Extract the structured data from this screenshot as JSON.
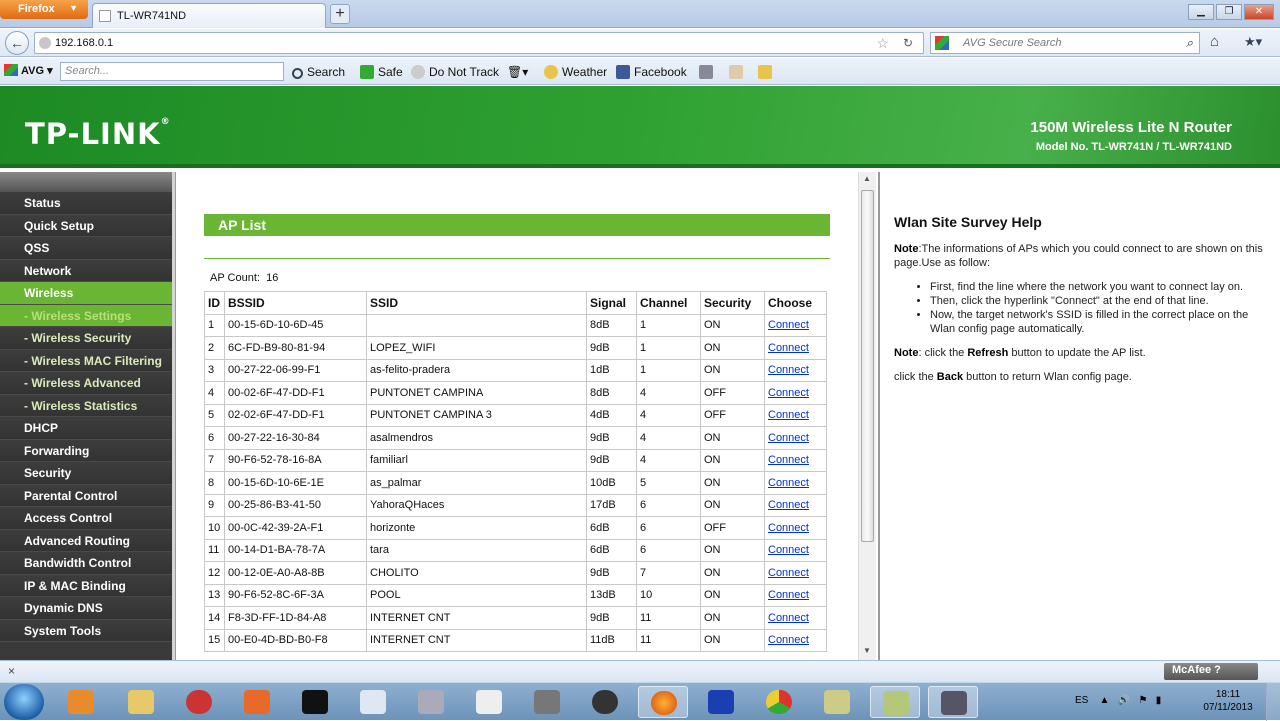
{
  "browser": {
    "menu_button": "Firefox",
    "tab_title": "TL-WR741ND",
    "url": "192.168.0.1",
    "search_placeholder": "AVG Secure Search",
    "toolbar": {
      "avg_label": "AVG",
      "search_placeholder": "Search...",
      "search_button": "Search",
      "safe": "Safe",
      "do_not_track": "Do Not Track",
      "weather": "Weather",
      "facebook": "Facebook"
    }
  },
  "router": {
    "brand": "TP-LINK",
    "brand_mark": "®",
    "product": "150M Wireless Lite N Router",
    "model": "Model No. TL-WR741N / TL-WR741ND",
    "menu": [
      {
        "label": "Status",
        "sub": false,
        "active": false
      },
      {
        "label": "Quick Setup",
        "sub": false,
        "active": false
      },
      {
        "label": "QSS",
        "sub": false,
        "active": false
      },
      {
        "label": "Network",
        "sub": false,
        "active": false
      },
      {
        "label": "Wireless",
        "sub": false,
        "active": true
      },
      {
        "label": "- Wireless Settings",
        "sub": true,
        "active": true
      },
      {
        "label": "- Wireless Security",
        "sub": true,
        "active": false
      },
      {
        "label": "- Wireless MAC Filtering",
        "sub": true,
        "active": false
      },
      {
        "label": "- Wireless Advanced",
        "sub": true,
        "active": false
      },
      {
        "label": "- Wireless Statistics",
        "sub": true,
        "active": false
      },
      {
        "label": "DHCP",
        "sub": false,
        "active": false
      },
      {
        "label": "Forwarding",
        "sub": false,
        "active": false
      },
      {
        "label": "Security",
        "sub": false,
        "active": false
      },
      {
        "label": "Parental Control",
        "sub": false,
        "active": false
      },
      {
        "label": "Access Control",
        "sub": false,
        "active": false
      },
      {
        "label": "Advanced Routing",
        "sub": false,
        "active": false
      },
      {
        "label": "Bandwidth Control",
        "sub": false,
        "active": false
      },
      {
        "label": "IP & MAC Binding",
        "sub": false,
        "active": false
      },
      {
        "label": "Dynamic DNS",
        "sub": false,
        "active": false
      },
      {
        "label": "System Tools",
        "sub": false,
        "active": false
      }
    ],
    "ap_list": {
      "title": "AP List",
      "count_label": "AP Count:",
      "count": "16",
      "headers": [
        "ID",
        "BSSID",
        "SSID",
        "Signal",
        "Channel",
        "Security",
        "Choose"
      ],
      "rows": [
        [
          "1",
          "00-15-6D-10-6D-45",
          "",
          "8dB",
          "1",
          "ON",
          "Connect"
        ],
        [
          "2",
          "6C-FD-B9-80-81-94",
          "LOPEZ_WIFI",
          "9dB",
          "1",
          "ON",
          "Connect"
        ],
        [
          "3",
          "00-27-22-06-99-F1",
          "as-felito-pradera",
          "1dB",
          "1",
          "ON",
          "Connect"
        ],
        [
          "4",
          "00-02-6F-47-DD-F1",
          "PUNTONET CAMPINA",
          "8dB",
          "4",
          "OFF",
          "Connect"
        ],
        [
          "5",
          "02-02-6F-47-DD-F1",
          "PUNTONET CAMPINA 3",
          "4dB",
          "4",
          "OFF",
          "Connect"
        ],
        [
          "6",
          "00-27-22-16-30-84",
          "asalmendros",
          "9dB",
          "4",
          "ON",
          "Connect"
        ],
        [
          "7",
          "90-F6-52-78-16-8A",
          "familiarl",
          "9dB",
          "4",
          "ON",
          "Connect"
        ],
        [
          "8",
          "00-15-6D-10-6E-1E",
          "as_palmar",
          "10dB",
          "5",
          "ON",
          "Connect"
        ],
        [
          "9",
          "00-25-86-B3-41-50",
          "YahoraQHaces",
          "17dB",
          "6",
          "ON",
          "Connect"
        ],
        [
          "10",
          "00-0C-42-39-2A-F1",
          "horizonte",
          "6dB",
          "6",
          "OFF",
          "Connect"
        ],
        [
          "11",
          "00-14-D1-BA-78-7A",
          "tara",
          "6dB",
          "6",
          "ON",
          "Connect"
        ],
        [
          "12",
          "00-12-0E-A0-A8-8B",
          "CHOLITO",
          "9dB",
          "7",
          "ON",
          "Connect"
        ],
        [
          "13",
          "90-F6-52-8C-6F-3A",
          "POOL",
          "13dB",
          "10",
          "ON",
          "Connect"
        ],
        [
          "14",
          "F8-3D-FF-1D-84-A8",
          "INTERNET CNT",
          "9dB",
          "11",
          "ON",
          "Connect"
        ],
        [
          "15",
          "00-E0-4D-BD-B0-F8",
          "INTERNET CNT",
          "11dB",
          "11",
          "ON",
          "Connect"
        ]
      ]
    },
    "help": {
      "title": "Wlan Site Survey Help",
      "note1_label": "Note",
      "note1_text": ":The informations of APs which you could connect to are shown on this page.Use as follow:",
      "bullets": [
        "First, find the line where the network you want to connect lay on.",
        "Then, click the hyperlink \"Connect\" at the end of that line.",
        "Now, the target network's SSID is filled in the correct place on the Wlan config page automatically."
      ],
      "note2_label": "Note",
      "note2_pre": ": click the ",
      "refresh": "Refresh",
      "note2_post": " button to update the AP list.",
      "back_pre": "click the ",
      "back": "Back",
      "back_post": " button to return Wlan config page."
    }
  },
  "addon_bar": {
    "close": "×",
    "mcafee": "McAfee"
  },
  "taskbar": {
    "language": "ES",
    "time": "18:11",
    "date": "07/11/2013"
  }
}
